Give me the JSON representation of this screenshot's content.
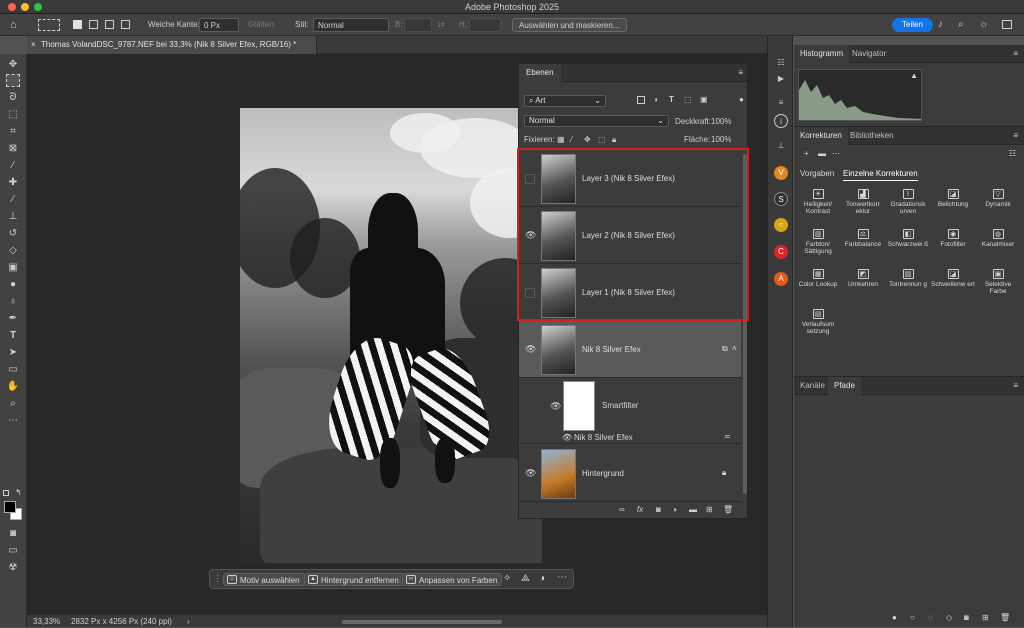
{
  "app": {
    "title": "Adobe Photoshop 2025"
  },
  "options_bar": {
    "feather_label": "Weiche Kante:",
    "feather_value": "0 Px",
    "smooth_label": "Glätten",
    "style_label": "Stil:",
    "style_value": "Normal",
    "width_label": "B:",
    "height_label": "H:",
    "select_mask_button": "Auswählen und maskieren...",
    "share_button": "Teilen"
  },
  "document_tab": {
    "title": "Thomas VolandDSC_9787.NEF bei 33,3% (Nik 8 Silver Efex, RGB/16) *"
  },
  "contextual_taskbar": {
    "select_subject": "Motiv auswählen",
    "remove_background": "Hintergrund entfernen",
    "adjust_colors": "Anpassen von Farben"
  },
  "status_bar": {
    "zoom": "33,33%",
    "doc_info": "2832 Px x 4256 Px (240 ppi)"
  },
  "layers_panel": {
    "tab": "Ebenen",
    "filter_kind": "Art",
    "blend_mode": "Normal",
    "opacity_label": "Deckkraft:",
    "opacity_value": "100%",
    "lock_label": "Fixieren:",
    "fill_label": "Fläche:",
    "fill_value": "100%",
    "layers": [
      {
        "name": "Layer 3 (Nik 8 Silver Efex)",
        "visible": false
      },
      {
        "name": "Layer 2 (Nik 8 Silver Efex)",
        "visible": true
      },
      {
        "name": "Layer 1 (Nik 8 Silver Efex)",
        "visible": false
      },
      {
        "name": "Nik 8 Silver Efex",
        "visible": true
      },
      {
        "name": "Hintergrund",
        "visible": true
      }
    ],
    "smart_filter_label": "Smartfilter",
    "smart_filter_item": "Nik 8 Silver Efex"
  },
  "histogram_panel": {
    "tab_active": "Histogramm",
    "tab_other": "Navigator"
  },
  "corrections_panel": {
    "tab_active": "Korrekturen",
    "tab_other": "Bibliotheken",
    "subtab_presets": "Vorgaben",
    "subtab_single": "Einzelne Korrekturen",
    "items": [
      "Helligkeit/ Kontrast",
      "Tonwertkorr ektur",
      "Gradationsk urven",
      "Belichtung",
      "Dynamik",
      "Farbton/ Sättigung",
      "Farbbalance",
      "Schwarzwei ß",
      "Fotofilter",
      "Kanalmixer",
      "Color Lookup",
      "Umkehren",
      "Tontrennun g",
      "Schwellenw ert",
      "Selektive Farbe",
      "Verlaufsum setzung"
    ]
  },
  "channels_panel": {
    "tab_other": "Kanäle",
    "tab_active": "Pfade"
  }
}
